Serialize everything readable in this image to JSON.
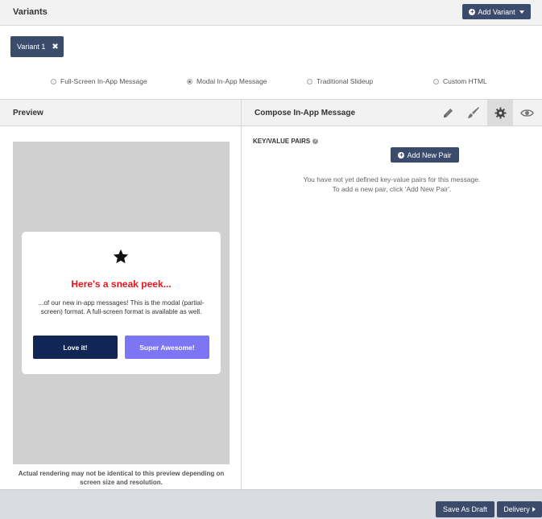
{
  "variants": {
    "title": "Variants",
    "add_variant_label": "Add Variant",
    "chip_label": "Variant 1",
    "chip_close": "✖"
  },
  "message_types": [
    {
      "label": "Full-Screen In-App Message",
      "selected": false
    },
    {
      "label": "Modal In-App Message",
      "selected": true
    },
    {
      "label": "Traditional Slideup",
      "selected": false
    },
    {
      "label": "Custom HTML",
      "selected": false
    }
  ],
  "preview": {
    "title": "Preview",
    "headline": "Here's a sneak peek...",
    "body": "...of our new in-app messages! This is the modal (partial-screen) format. A full-screen format is available as well.",
    "button1": "Love it!",
    "button2": "Super Awesome!",
    "note": "Actual rendering may not be identical to this preview depending on screen size and resolution.",
    "headline_color": "#e8141c",
    "button1_color": "#122655",
    "button2_color": "#7c75f4",
    "icon": "star-icon"
  },
  "compose": {
    "title": "Compose In-App Message",
    "tools": [
      "pencil-icon",
      "brush-icon",
      "gear-icon",
      "eye-icon"
    ],
    "active_tool": "gear-icon",
    "kv_label": "KEY/VALUE PAIRS",
    "add_pair_label": "Add New Pair",
    "empty_line1": "You have not yet defined key-value pairs for this message.",
    "empty_line2": "To add a new pair, click 'Add New Pair'."
  },
  "footer": {
    "save_draft": "Save As Draft",
    "delivery": "Delivery"
  },
  "colors": {
    "accent": "#3b4b6b",
    "header_bg": "#f2f2f2",
    "footer_bg": "#d9dde2",
    "preview_bg": "#d0d0d0"
  }
}
